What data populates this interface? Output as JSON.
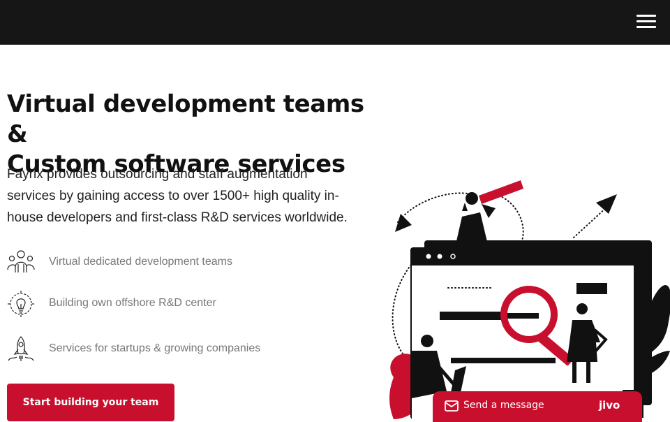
{
  "header": {
    "menu_icon": "hamburger-menu-icon"
  },
  "hero": {
    "title_line1": "Virtual development teams &",
    "title_line2": "Custom software services",
    "description": "Fayrix provides outsourcing and staff augmentation services by gaining access to over 1500+ high quality in-house developers and first-class R&D services worldwide."
  },
  "features": [
    {
      "icon": "team-people-icon",
      "label": "Virtual dedicated development teams"
    },
    {
      "icon": "lightbulb-gear-icon",
      "label": "Building own offshore R&D center"
    },
    {
      "icon": "rocket-icon",
      "label": "Services for startups & growing companies"
    }
  ],
  "cta": {
    "label": "Start building your team"
  },
  "chat": {
    "icon": "mail-icon",
    "label": "Send a message",
    "brand": "jivo"
  },
  "colors": {
    "header_bg": "#161616",
    "accent": "#c8102e",
    "text": "#111111",
    "muted": "#777777"
  }
}
